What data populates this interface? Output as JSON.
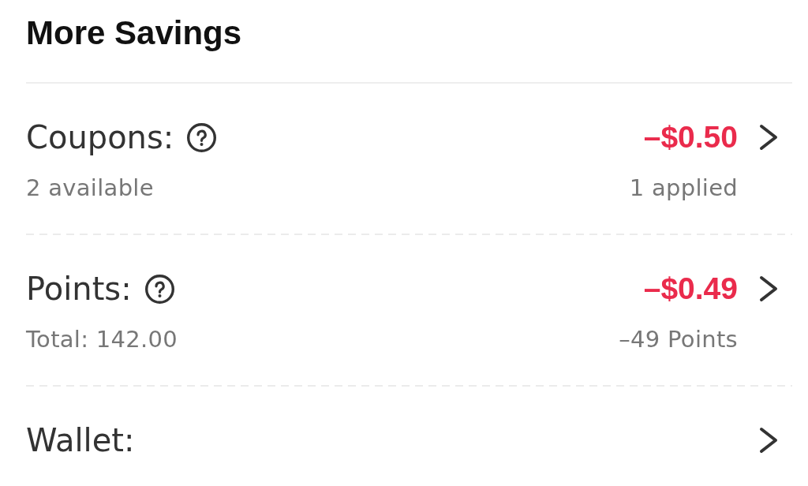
{
  "title": "More Savings",
  "items": [
    {
      "label": "Coupons:",
      "has_help": true,
      "amount": "–$0.50",
      "detail_left": "2 available",
      "detail_right": "1 applied"
    },
    {
      "label": "Points:",
      "has_help": true,
      "amount": "–$0.49",
      "detail_left": "Total: 142.00",
      "detail_right": "–49 Points"
    },
    {
      "label": "Wallet:",
      "has_help": false
    }
  ]
}
